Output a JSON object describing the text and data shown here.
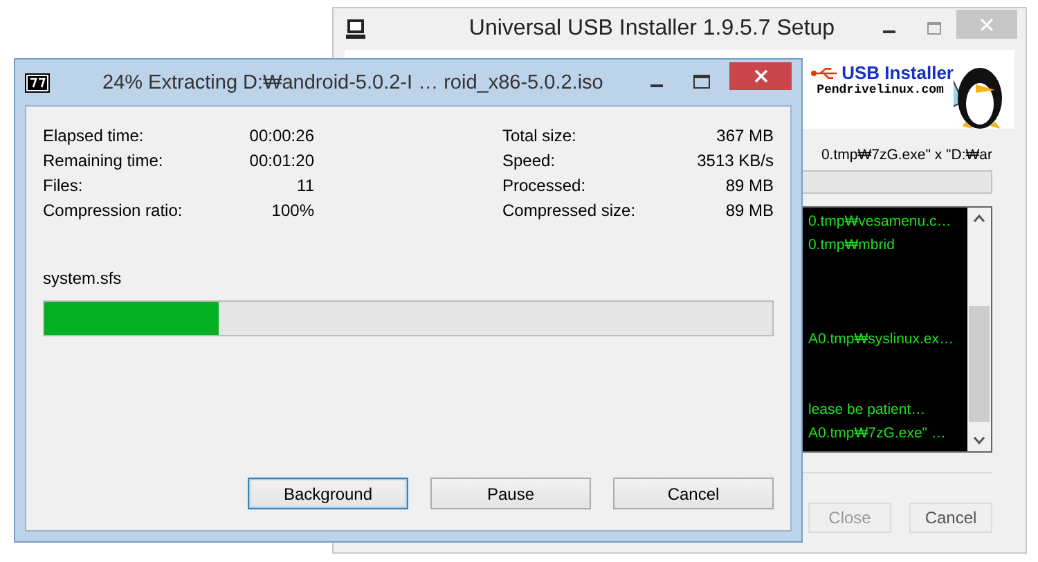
{
  "back_window": {
    "title": "Universal USB Installer 1.9.5.7 Setup",
    "logo_title": "USB Installer",
    "logo_site": "Pendrivelinux.com",
    "command_line": "0.tmp₩7zG.exe\" x \"D:₩ar",
    "log_lines": [
      "0.tmp₩vesamenu.c…",
      "0.tmp₩mbrid",
      "A0.tmp₩syslinux.ex…",
      "lease be patient…",
      "A0.tmp₩7zG.exe\" …"
    ],
    "buttons": [
      {
        "label": "Close",
        "disabled": true
      },
      {
        "label": "Cancel",
        "disabled": false
      }
    ]
  },
  "front_window": {
    "title": "24% Extracting D:₩android-5.0.2-I … roid_x86-5.0.2.iso",
    "stats_left": [
      {
        "label": "Elapsed time:",
        "value": "00:00:26"
      },
      {
        "label": "Remaining time:",
        "value": "00:01:20"
      },
      {
        "label": "Files:",
        "value": "11"
      },
      {
        "label": "Compression ratio:",
        "value": "100%"
      }
    ],
    "stats_right": [
      {
        "label": "Total size:",
        "value": "367 MB"
      },
      {
        "label": "Speed:",
        "value": "3513 KB/s"
      },
      {
        "label": "Processed:",
        "value": "89 MB"
      },
      {
        "label": "Compressed size:",
        "value": "89 MB"
      }
    ],
    "current_file": "system.sfs",
    "progress": {
      "level": 0.24
    },
    "buttons": [
      {
        "label": "Background",
        "focused": true
      },
      {
        "label": "Pause",
        "focused": false
      },
      {
        "label": "Cancel",
        "focused": false
      }
    ]
  }
}
